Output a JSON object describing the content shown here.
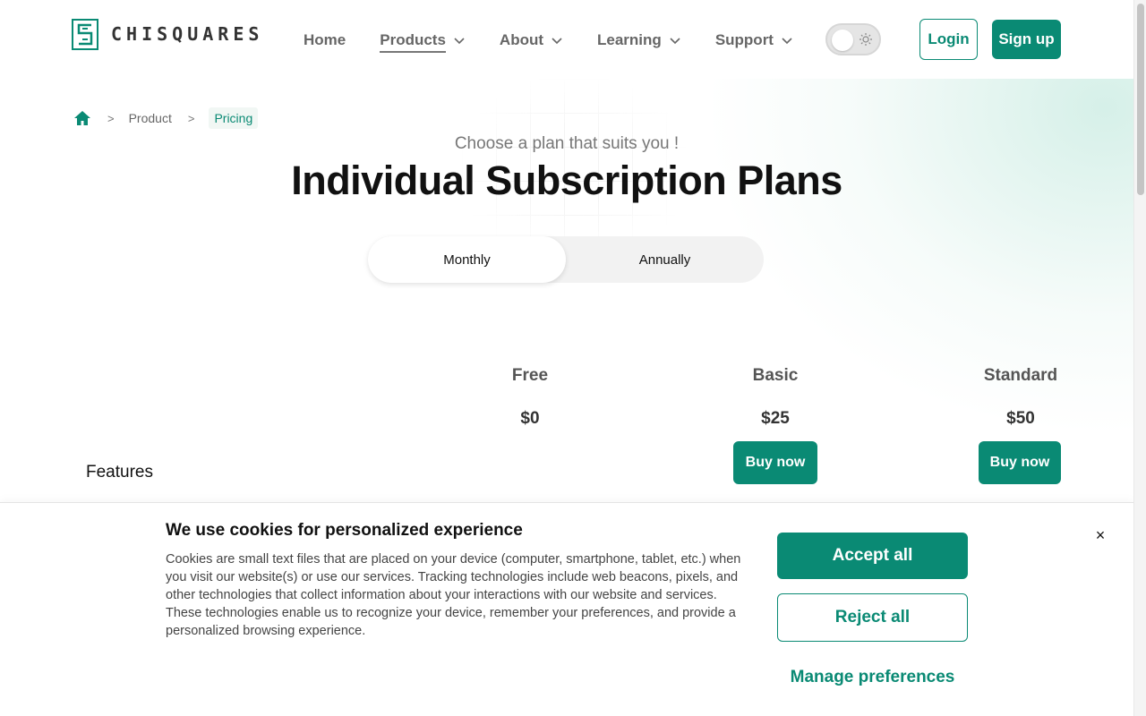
{
  "header": {
    "brand": "CHISQUARES",
    "nav": [
      {
        "label": "Home",
        "has_dropdown": false,
        "active": false
      },
      {
        "label": "Products",
        "has_dropdown": true,
        "active": true
      },
      {
        "label": "About",
        "has_dropdown": true,
        "active": false
      },
      {
        "label": "Learning",
        "has_dropdown": true,
        "active": false
      },
      {
        "label": "Support",
        "has_dropdown": true,
        "active": false
      }
    ],
    "login_label": "Login",
    "signup_label": "Sign up"
  },
  "breadcrumb": {
    "items": [
      "Product",
      "Pricing"
    ]
  },
  "hero": {
    "subtitle": "Choose a plan that suits you !",
    "title": "Individual Subscription Plans",
    "period_options": [
      "Monthly",
      "Annually"
    ],
    "selected_period": "Monthly"
  },
  "plans": [
    {
      "name": "Free",
      "price": "$0",
      "button": ""
    },
    {
      "name": "Basic",
      "price": "$25",
      "button": "Buy now"
    },
    {
      "name": "Standard",
      "price": "$50",
      "button": "Buy now"
    }
  ],
  "features_label": "Features",
  "cookie": {
    "title": "We use cookies for personalized experience",
    "text": "Cookies are small text files that are placed on your device (computer, smartphone, tablet, etc.) when you visit our website(s) or use our services. Tracking technologies include web beacons, pixels, and other technologies that collect information about your interactions with our website and services. These technologies enable us to recognize your device, remember your preferences, and provide a personalized browsing experience.",
    "accept_label": "Accept all",
    "reject_label": "Reject all",
    "manage_label": "Manage preferences",
    "close_symbol": "×"
  },
  "colors": {
    "brand": "#0a8a74",
    "text": "#111111",
    "muted": "#666666"
  }
}
